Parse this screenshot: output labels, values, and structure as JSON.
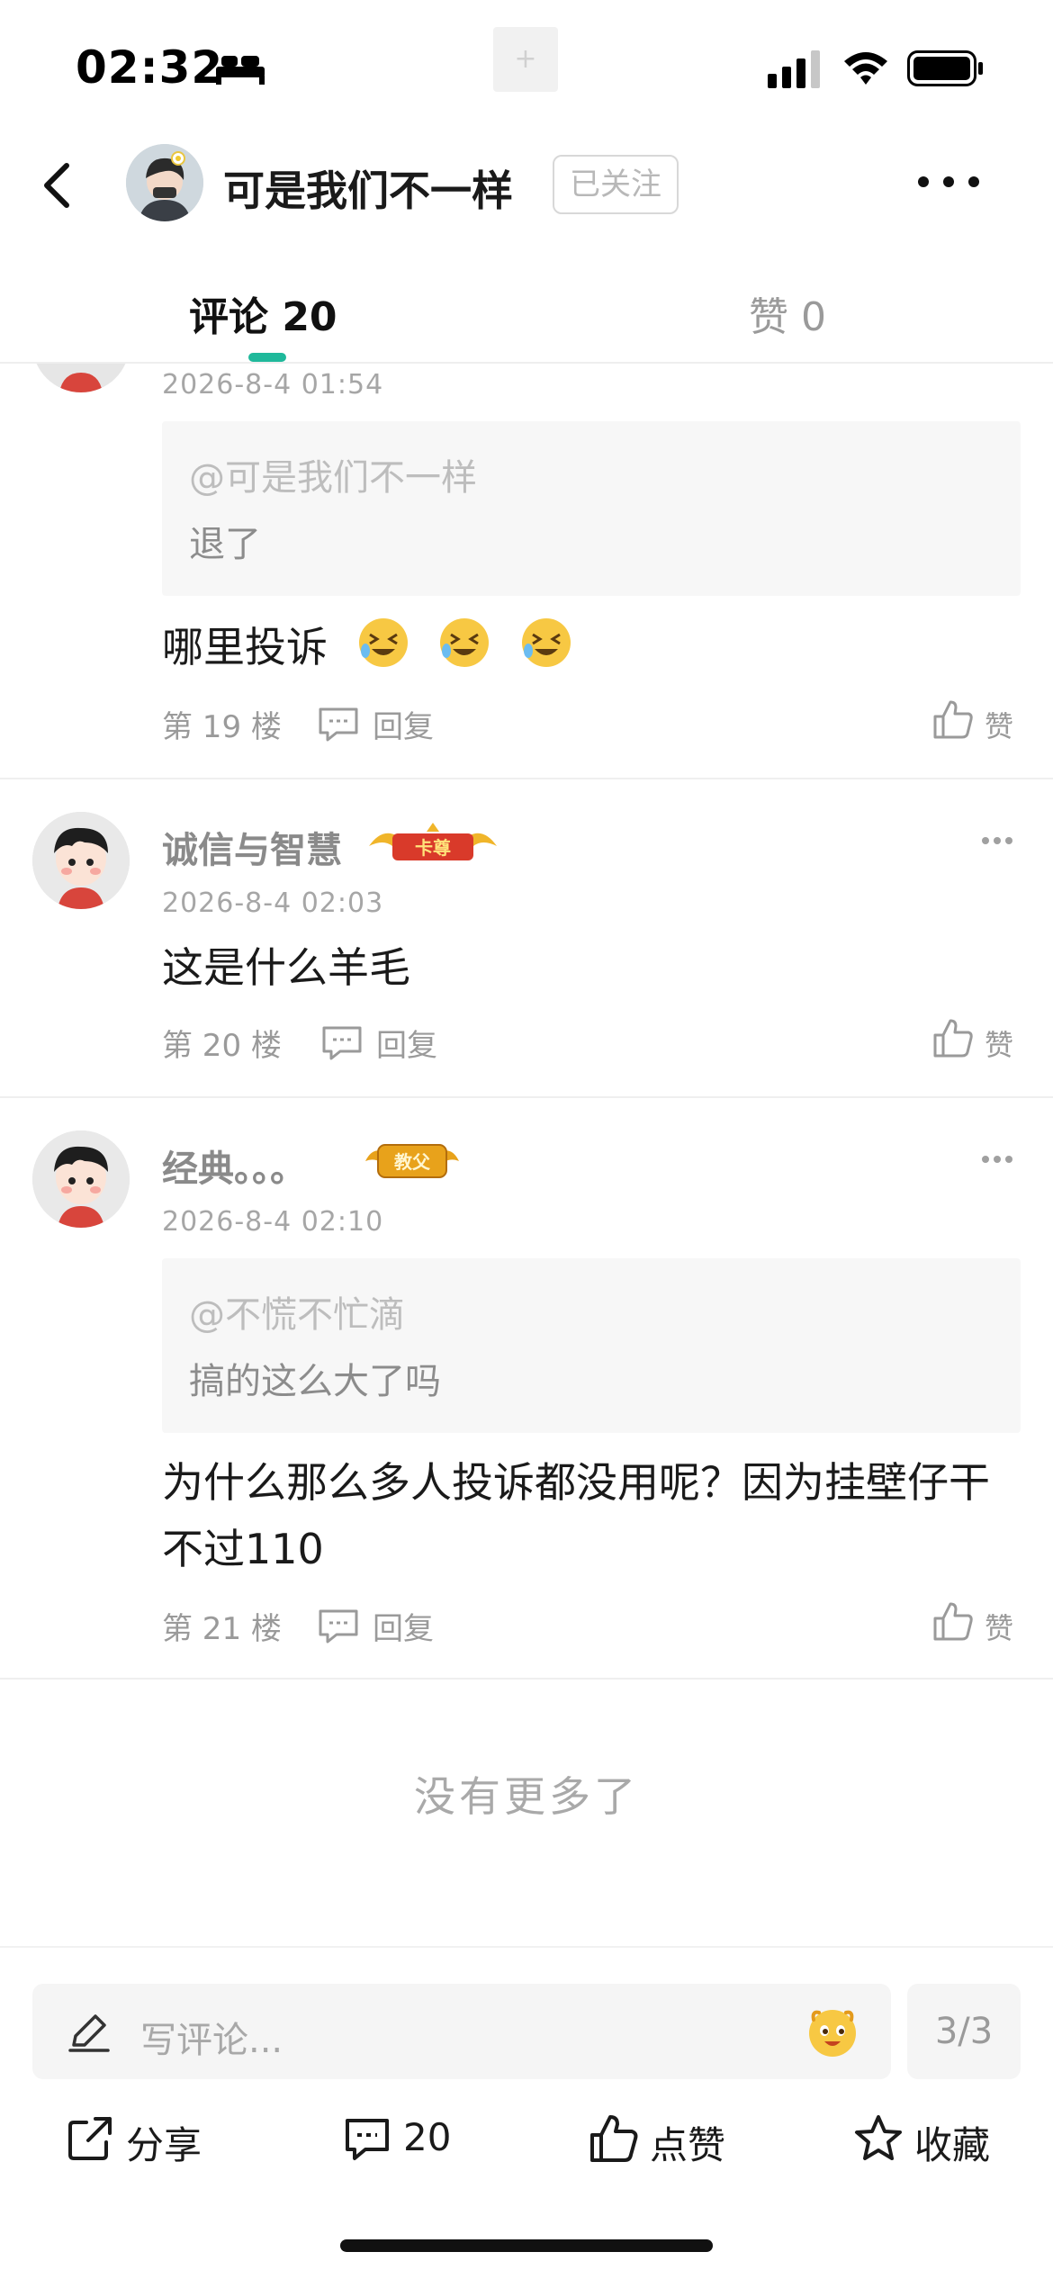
{
  "status_bar": {
    "time": "02:32",
    "notch_plus": "+"
  },
  "header": {
    "user_name": "可是我们不一样",
    "follow_label": "已关注"
  },
  "tabs": [
    {
      "label": "评论 20"
    },
    {
      "label": "赞 0"
    }
  ],
  "comments": [
    {
      "time": "2026-8-4 01:54",
      "quote_at": "@可是我们不一样",
      "quote_text": "退了",
      "text": "哪里投诉",
      "emoji_icon": "grinning-squint-emoji",
      "floor": "第 19 楼",
      "reply_label": "回复",
      "like_label": "赞"
    },
    {
      "name": "诚信与智慧",
      "badge_text": "卡尊",
      "time": "2026-8-4 02:03",
      "text": "这是什么羊毛",
      "floor": "第 20 楼",
      "reply_label": "回复",
      "like_label": "赞"
    },
    {
      "name": "经典。。。",
      "badge_text": "教父",
      "time": "2026-8-4 02:10",
      "quote_at": "@不慌不忙滴",
      "quote_text": "搞的这么大了吗",
      "text": "为什么那么多人投诉都没用呢？因为挂壁仔干不过110",
      "floor": "第 21 楼",
      "reply_label": "回复",
      "like_label": "赞"
    }
  ],
  "no_more": "没有更多了",
  "bottom": {
    "input_placeholder": "写评论...",
    "page_indicator": "3/3",
    "actions": [
      {
        "label": "分享",
        "icon": "share-icon"
      },
      {
        "label": "20",
        "icon": "comment-icon"
      },
      {
        "label": "点赞",
        "icon": "thumb-up-icon"
      },
      {
        "label": "收藏",
        "icon": "star-icon"
      }
    ]
  },
  "colors": {
    "accent": "#1fb99b",
    "badge_red": "#d93a2a",
    "badge_gold": "#e8a21b"
  }
}
